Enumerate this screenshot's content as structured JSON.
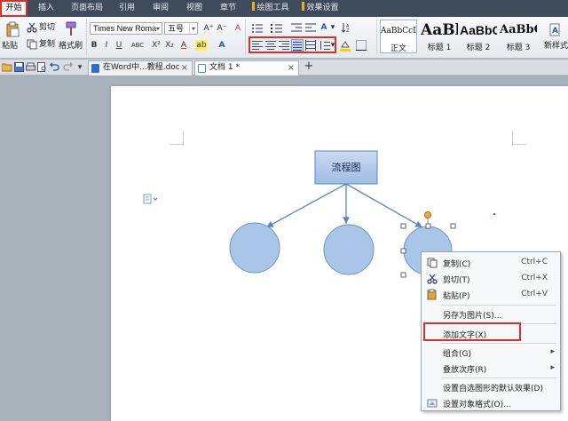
{
  "ribbon_tabs": [
    {
      "label": "开始",
      "active": true
    },
    {
      "label": "插入"
    },
    {
      "label": "页面布局"
    },
    {
      "label": "引用"
    },
    {
      "label": "审阅"
    },
    {
      "label": "视图"
    },
    {
      "label": "章节"
    },
    {
      "label": "绘图工具"
    },
    {
      "label": "效果设置"
    }
  ],
  "clipboard": {
    "paste": "粘贴",
    "cut": "剪切",
    "copy": "复制",
    "format_painter": "格式刷"
  },
  "font": {
    "name": "Times New Roma",
    "size": "五号"
  },
  "font_buttons": {
    "grow": "A⁺",
    "shrink": "A⁻",
    "clear": "A",
    "bold": "B",
    "italic": "I",
    "underline": "U",
    "strike": "ABC",
    "superscript": "X²",
    "subscript": "X₂",
    "color": "A",
    "highlight": "ab"
  },
  "styles": [
    {
      "preview": "AaBbCcDd",
      "name": "正文"
    },
    {
      "preview": "AaBl",
      "name": "标题 1"
    },
    {
      "preview": "AaBbC",
      "name": "标题 2"
    },
    {
      "preview": "AaBbC",
      "name": "标题 3"
    },
    {
      "name": "新样式"
    }
  ],
  "doc_tabs": [
    {
      "label": "在Word中...教程.doc",
      "close": "×"
    },
    {
      "label": "文档 1 *",
      "close": "×"
    }
  ],
  "new_tab": "+",
  "flowchart": {
    "box_label": "流程图"
  },
  "context_menu": {
    "items": [
      {
        "label": "复制(C)",
        "shortcut": "Ctrl+C",
        "icon": "copy-icon"
      },
      {
        "label": "剪切(T)",
        "shortcut": "Ctrl+X",
        "icon": "scissors-icon"
      },
      {
        "label": "粘贴(P)",
        "shortcut": "Ctrl+V",
        "icon": "paste-icon"
      },
      {
        "label": "另存为图片(S)..."
      },
      {
        "label": "添加文字(X)",
        "highlighted": true
      },
      {
        "label": "组合(G)",
        "submenu": true
      },
      {
        "label": "叠放次序(R)",
        "submenu": true
      },
      {
        "label": "设置自选图形的默认效果(D)"
      },
      {
        "label": "设置对象格式(O)...",
        "icon": "format-icon"
      }
    ]
  },
  "colors": {
    "accent_red": "#d9312a",
    "shape_fill": "#a9c6e8",
    "shape_stroke": "#6d94c3",
    "tab_bar": "#3f4a5a"
  }
}
